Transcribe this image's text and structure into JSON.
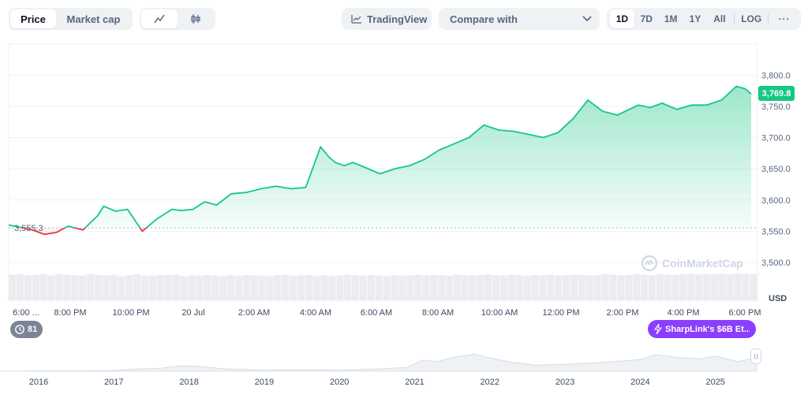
{
  "toolbar": {
    "metric_tabs": [
      "Price",
      "Market cap"
    ],
    "chart_type_icons": [
      "line-chart-icon",
      "candlestick-icon"
    ],
    "tradingview_label": "TradingView",
    "compare_label": "Compare with",
    "ranges": [
      "1D",
      "7D",
      "1M",
      "1Y",
      "All"
    ],
    "log_label": "LOG",
    "more_label": "···"
  },
  "colors": {
    "up": "#16c784",
    "down": "#ea3943",
    "accent_purple": "#8a3ffc"
  },
  "events_count": "81",
  "news_label": "SharpLink's $6B Et...",
  "watermark": "CoinMarketCap",
  "currency": "USD",
  "navigator_years": [
    "2016",
    "2017",
    "2018",
    "2019",
    "2020",
    "2021",
    "2022",
    "2023",
    "2024",
    "2025"
  ],
  "chart_data": {
    "type": "area",
    "x_tick_labels": [
      "6:00 ...",
      "8:00 PM",
      "10:00 PM",
      "20 Jul",
      "2:00 AM",
      "4:00 AM",
      "6:00 AM",
      "8:00 AM",
      "10:00 AM",
      "12:00 PM",
      "2:00 PM",
      "4:00 PM",
      "6:00 PM"
    ],
    "y_ticks": [
      3500,
      3550,
      3600,
      3650,
      3700,
      3750,
      3800
    ],
    "y_tick_labels": [
      "3,500.0",
      "3,550.0",
      "3,600.0",
      "3,650.0",
      "3,700.0",
      "3,750.0",
      "3,800.0"
    ],
    "ylim": [
      3500,
      3820
    ],
    "x_range_hours": [
      0,
      25
    ],
    "baseline_value": 3555.3,
    "baseline_label": "3,555.3",
    "current_value": 3769.8,
    "current_label": "3,769.8",
    "x": [
      0,
      0.8,
      1.2,
      1.6,
      2.0,
      2.5,
      3.0,
      3.2,
      3.6,
      4.0,
      4.5,
      5.0,
      5.5,
      5.8,
      6.2,
      6.6,
      7.0,
      7.5,
      8.0,
      8.5,
      9.0,
      9.5,
      10.0,
      10.5,
      10.8,
      11.0,
      11.3,
      11.6,
      12.0,
      12.5,
      13.0,
      13.5,
      14.0,
      14.5,
      15.0,
      15.5,
      16.0,
      16.5,
      17.0,
      17.5,
      18.0,
      18.5,
      19.0,
      19.5,
      20.0,
      20.5,
      20.8,
      21.2,
      21.6,
      22.0,
      22.5,
      23.0,
      23.5,
      24.0,
      24.5,
      24.8,
      25.0
    ],
    "values": [
      3560,
      3552,
      3545,
      3548,
      3558,
      3552,
      3575,
      3590,
      3582,
      3585,
      3550,
      3570,
      3585,
      3583,
      3585,
      3597,
      3592,
      3610,
      3612,
      3618,
      3622,
      3618,
      3620,
      3685,
      3668,
      3660,
      3655,
      3660,
      3652,
      3642,
      3650,
      3655,
      3665,
      3680,
      3690,
      3700,
      3720,
      3712,
      3710,
      3705,
      3700,
      3708,
      3730,
      3760,
      3742,
      3736,
      3743,
      3752,
      3748,
      3755,
      3745,
      3752,
      3752,
      3760,
      3782,
      3778,
      3769.8
    ]
  },
  "volume_range": [
    0,
    1
  ],
  "volume": [
    0.88,
    0.9,
    0.86,
    0.87,
    0.89,
    0.85,
    0.9,
    0.88,
    0.86,
    0.84,
    0.9,
    0.87,
    0.86,
    0.88,
    0.83,
    0.86,
    0.89,
    0.85,
    0.84,
    0.87,
    0.86,
    0.88,
    0.82,
    0.86,
    0.84,
    0.87,
    0.85,
    0.83,
    0.86,
    0.84,
    0.87,
    0.86,
    0.84,
    0.82,
    0.86,
    0.88,
    0.84,
    0.85,
    0.87,
    0.83,
    0.86,
    0.84,
    0.85,
    0.88,
    0.86,
    0.84,
    0.87,
    0.85,
    0.82,
    0.86,
    0.84,
    0.86,
    0.88,
    0.85,
    0.87,
    0.86,
    0.84,
    0.88,
    0.86,
    0.85,
    0.87,
    0.89,
    0.86,
    0.85,
    0.88,
    0.86,
    0.84,
    0.87,
    0.86,
    0.88,
    0.85,
    0.86,
    0.88,
    0.87,
    0.85,
    0.86,
    0.9,
    0.88,
    0.86,
    0.87,
    0.89,
    0.88,
    0.86,
    0.9,
    0.88,
    0.87,
    0.89,
    0.91,
    0.88,
    0.9,
    0.89,
    0.91,
    0.9,
    0.92,
    0.91,
    0.9
  ],
  "navigator_range": [
    0,
    1
  ],
  "navigator_x_years": [
    2015.5,
    2016.0,
    2016.5,
    2017.0,
    2017.3,
    2017.6,
    2017.9,
    2018.1,
    2018.5,
    2019.0,
    2019.5,
    2020.0,
    2020.5,
    2020.9,
    2021.1,
    2021.3,
    2021.5,
    2021.8,
    2022.0,
    2022.3,
    2022.6,
    2023.0,
    2023.5,
    2024.0,
    2024.2,
    2024.5,
    2024.8,
    2025.0,
    2025.3,
    2025.55
  ],
  "navigator_values": [
    0.0,
    0.01,
    0.01,
    0.02,
    0.08,
    0.1,
    0.2,
    0.18,
    0.08,
    0.04,
    0.05,
    0.04,
    0.08,
    0.14,
    0.4,
    0.35,
    0.5,
    0.62,
    0.48,
    0.32,
    0.22,
    0.25,
    0.32,
    0.42,
    0.6,
    0.5,
    0.45,
    0.55,
    0.35,
    0.5
  ]
}
